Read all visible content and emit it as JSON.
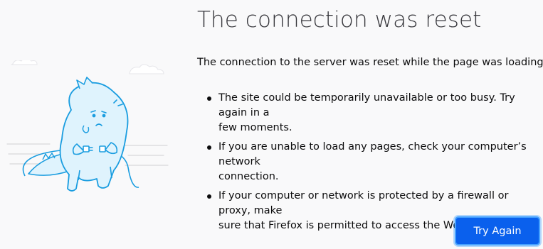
{
  "page": {
    "title": "The connection was reset",
    "description": "The connection to the server was reset while the page was loading.",
    "reasons": [
      {
        "line1": "The site could be temporarily unavailable or too busy. Try again in a",
        "line2": "few moments."
      },
      {
        "line1": "If you are unable to load any pages, check your computer’s network",
        "line2": "connection."
      },
      {
        "line1": "If your computer or network is protected by a firewall or proxy, make",
        "line2": "sure that Firefox is permitted to access the Web."
      }
    ],
    "try_again_label": "Try Again"
  },
  "illustration": {
    "icon": "disconnected-dinosaur-icon"
  },
  "colors": {
    "background": "#f9f9fa",
    "button": "#0a60ed",
    "illustration_stroke": "#1a9de0",
    "illustration_fill": "#dff3fd"
  }
}
